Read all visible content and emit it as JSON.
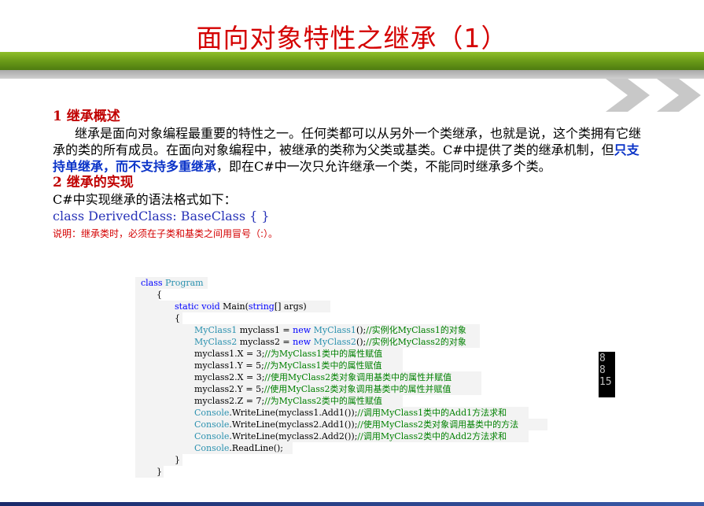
{
  "slide": {
    "title": "面向对象特性之继承（1）"
  },
  "section1": {
    "heading": "1  继承概述",
    "para_part1": "继承是面向对象编程最重要的特性之一。任何类都可以从另外一个类继承，也就是说，这个类拥有它继承的类的所有成员。在面向对象编程中，被继承的类称为父类或基类。C#中提供了类的继承机制，但",
    "para_emph": "只支持单继承，而不支持多重继承",
    "para_part2": "，即在C#中一次只允许继承一个类，不能同时继承多个类。"
  },
  "section2": {
    "heading": "2  继承的实现",
    "intro": "C#中实现继承的语法格式如下：",
    "declaration": "class DerivedClass: BaseClass { }",
    "note": "说明：继承类时，必须在子类和基类之间用冒号（:）。"
  },
  "code": {
    "l1_kw": "class",
    "l1_ty": "Program",
    "l2": "{",
    "l3_kw1": "static",
    "l3_kw2": "void",
    "l3_mid": "Main(",
    "l3_kw3": "string",
    "l3_end": "[] args)",
    "l4": "{",
    "l5_ty1": "MyClass1",
    "l5_mid": "myclass1 = ",
    "l5_kw": "new",
    "l5_ty2": "MyClass1",
    "l5_end": "();",
    "l5_cm": "//实例化MyClass1的对象",
    "l6_ty1": "MyClass2",
    "l6_mid": "myclass2 = ",
    "l6_kw": "new",
    "l6_ty2": "MyClass2",
    "l6_end": "();",
    "l6_cm": "//实例化MyClass2的对象",
    "l7_code": "myclass1.X = 3;",
    "l7_cm": "//为MyClass1类中的属性赋值",
    "l8_code": "myclass1.Y = 5;",
    "l8_cm": "//为MyClass1类中的属性赋值",
    "l9_code": "myclass2.X = 3;",
    "l9_cm": "//使用MyClass2类对象调用基类中的属性并赋值",
    "l10_code": "myclass2.Y = 5;",
    "l10_cm": "//使用MyClass2类对象调用基类中的属性并赋值",
    "l11_code": "myclass2.Z = 7;",
    "l11_cm": "//为MyClass2类中的属性赋值",
    "l12_ty": "Console",
    "l12_code": ".WriteLine(myclass1.Add1());",
    "l12_cm": "//调用MyClass1类中的Add1方法求和",
    "l13_ty": "Console",
    "l13_code": ".WriteLine(myclass2.Add1());",
    "l13_cm": "//使用MyClass2类对象调用基类中的方法",
    "l14_ty": "Console",
    "l14_code": ".WriteLine(myclass2.Add2());",
    "l14_cm": "//调用MyClass2类中的Add2方法求和",
    "l15_ty": "Console",
    "l15_code": ".ReadLine();",
    "l16": "}",
    "l17": "}"
  },
  "console_output": [
    "8",
    "8",
    "15"
  ],
  "colors": {
    "title": "#d40000",
    "heading": "#c00000",
    "emphasis": "#0a33c8",
    "keyword": "#0000ff",
    "type": "#2b91af",
    "comment": "#008000",
    "band_green": "#6a9a18"
  }
}
